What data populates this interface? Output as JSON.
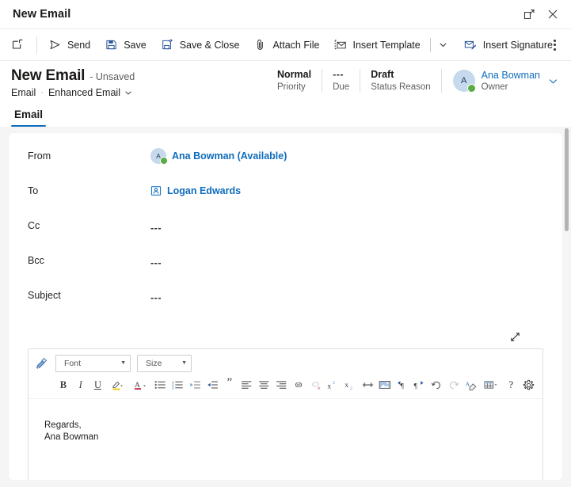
{
  "window": {
    "title": "New Email",
    "popout_icon": "popout-icon",
    "close_icon": "close-icon"
  },
  "commandbar": {
    "newwindow_icon": "open-in-new-window-icon",
    "items": [
      {
        "label": "Send",
        "icon": "send-icon"
      },
      {
        "label": "Save",
        "icon": "save-icon"
      },
      {
        "label": "Save & Close",
        "icon": "save-and-close-icon"
      },
      {
        "label": "Attach File",
        "icon": "paperclip-icon"
      },
      {
        "label": "Insert Template",
        "icon": "insert-template-icon"
      },
      {
        "label": "Insert Signature",
        "icon": "insert-signature-icon"
      }
    ],
    "split_caret": "chevron-down-icon",
    "overflow_label": "more-commands"
  },
  "record": {
    "title": "New Email",
    "unsaved": "- Unsaved",
    "entity": "Email",
    "separator": "·",
    "form_name": "Enhanced Email",
    "form_caret": "chevron-down-icon",
    "stats": [
      {
        "value": "Normal",
        "label": "Priority"
      },
      {
        "value": "---",
        "label": "Due"
      },
      {
        "value": "Draft",
        "label": "Status Reason"
      }
    ],
    "owner": {
      "initial": "A",
      "name": "Ana Bowman",
      "role": "Owner",
      "caret": "chevron-down-icon",
      "presence": "available"
    }
  },
  "tabs": [
    {
      "label": "Email",
      "active": true
    }
  ],
  "form": {
    "fields": [
      {
        "label": "From",
        "type": "person",
        "initial": "A",
        "value": "Ana Bowman (Available)"
      },
      {
        "label": "To",
        "type": "contact",
        "value": "Logan Edwards"
      },
      {
        "label": "Cc",
        "type": "empty",
        "value": "---"
      },
      {
        "label": "Bcc",
        "type": "empty",
        "value": "---"
      },
      {
        "label": "Subject",
        "type": "empty",
        "value": "---"
      }
    ]
  },
  "editor": {
    "expand_icon": "expand-diagonal-icon",
    "format_painter_icon": "format-painter-icon",
    "font_select": {
      "value": "Font",
      "caret": "chevron-down-icon"
    },
    "size_select": {
      "value": "Size",
      "caret": "chevron-down-icon"
    },
    "buttons_row": [
      {
        "name": "bold-icon",
        "glyph": "B"
      },
      {
        "name": "italic-icon",
        "glyph": "I"
      },
      {
        "name": "underline-icon",
        "glyph": "U"
      },
      {
        "name": "highlight-color-icon",
        "glyph": ""
      },
      {
        "name": "font-color-icon",
        "glyph": "A"
      },
      {
        "name": "bulleted-list-icon",
        "glyph": ""
      },
      {
        "name": "numbered-list-icon",
        "glyph": ""
      },
      {
        "name": "decrease-indent-icon",
        "glyph": ""
      },
      {
        "name": "increase-indent-icon",
        "glyph": ""
      },
      {
        "name": "blockquote-icon",
        "glyph": "”"
      },
      {
        "name": "align-left-icon",
        "glyph": ""
      },
      {
        "name": "align-center-icon",
        "glyph": ""
      },
      {
        "name": "align-right-icon",
        "glyph": ""
      },
      {
        "name": "insert-link-icon",
        "glyph": ""
      },
      {
        "name": "remove-link-icon",
        "glyph": "",
        "disabled": true
      },
      {
        "name": "superscript-icon",
        "glyph": ""
      },
      {
        "name": "subscript-icon",
        "glyph": ""
      },
      {
        "name": "strikethrough-icon",
        "glyph": ""
      },
      {
        "name": "insert-image-icon",
        "glyph": ""
      },
      {
        "name": "left-to-right-icon",
        "glyph": ""
      },
      {
        "name": "right-to-left-icon",
        "glyph": ""
      },
      {
        "name": "undo-icon",
        "glyph": ""
      },
      {
        "name": "redo-icon",
        "glyph": "",
        "disabled": true
      },
      {
        "name": "clear-formatting-icon",
        "glyph": ""
      },
      {
        "name": "insert-table-icon",
        "glyph": ""
      },
      {
        "name": "help-icon",
        "glyph": "?"
      },
      {
        "name": "editor-settings-icon",
        "glyph": ""
      }
    ],
    "body_lines": [
      "Regards,",
      "Ana Bowman"
    ]
  },
  "colors": {
    "accent": "#0f6cbd",
    "link": "#0f6cbd",
    "presence_available": "#5aac44",
    "page_bg": "#f5f5f5",
    "card_bg": "#ffffff",
    "border": "#e1dfdd"
  }
}
